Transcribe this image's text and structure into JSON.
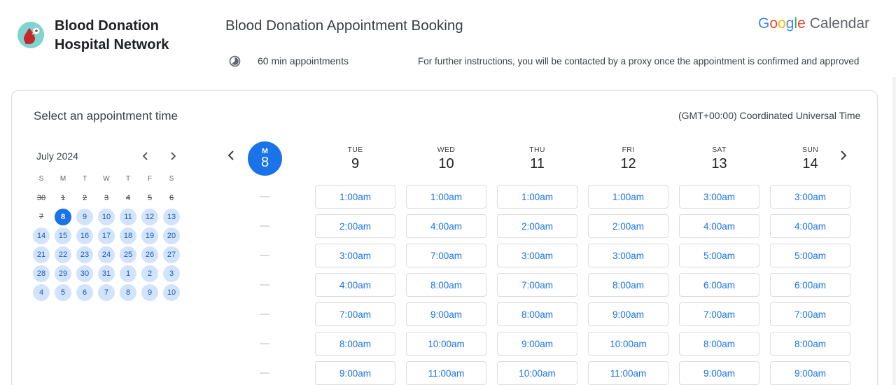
{
  "header": {
    "org_name": "Blood Donation Hospital Network",
    "title": "Blood Donation Appointment Booking",
    "duration": "60 min appointments",
    "instructions": "For further instructions, you will be contacted by a proxy once the appointment is confirmed and approved",
    "brand_google": "Google",
    "brand_calendar": "Calendar"
  },
  "main": {
    "select_title": "Select an appointment time",
    "timezone": "(GMT+00:00) Coordinated Universal Time"
  },
  "mini_calendar": {
    "month_label": "July 2024",
    "weekday_initials": [
      "S",
      "M",
      "T",
      "W",
      "T",
      "F",
      "S"
    ],
    "weeks": [
      [
        {
          "d": "30",
          "s": "past"
        },
        {
          "d": "1",
          "s": "past"
        },
        {
          "d": "2",
          "s": "past"
        },
        {
          "d": "3",
          "s": "past"
        },
        {
          "d": "4",
          "s": "past"
        },
        {
          "d": "5",
          "s": "past"
        },
        {
          "d": "6",
          "s": "past"
        }
      ],
      [
        {
          "d": "7",
          "s": "past"
        },
        {
          "d": "8",
          "s": "selected"
        },
        {
          "d": "9",
          "s": "avail"
        },
        {
          "d": "10",
          "s": "avail"
        },
        {
          "d": "11",
          "s": "avail"
        },
        {
          "d": "12",
          "s": "avail"
        },
        {
          "d": "13",
          "s": "avail"
        }
      ],
      [
        {
          "d": "14",
          "s": "avail"
        },
        {
          "d": "15",
          "s": "avail"
        },
        {
          "d": "16",
          "s": "avail"
        },
        {
          "d": "17",
          "s": "avail"
        },
        {
          "d": "18",
          "s": "avail"
        },
        {
          "d": "19",
          "s": "avail"
        },
        {
          "d": "20",
          "s": "avail"
        }
      ],
      [
        {
          "d": "21",
          "s": "avail"
        },
        {
          "d": "22",
          "s": "avail"
        },
        {
          "d": "23",
          "s": "avail"
        },
        {
          "d": "24",
          "s": "avail"
        },
        {
          "d": "25",
          "s": "avail"
        },
        {
          "d": "26",
          "s": "avail"
        },
        {
          "d": "27",
          "s": "avail"
        }
      ],
      [
        {
          "d": "28",
          "s": "avail"
        },
        {
          "d": "29",
          "s": "avail"
        },
        {
          "d": "30",
          "s": "avail"
        },
        {
          "d": "31",
          "s": "avail"
        },
        {
          "d": "1",
          "s": "avail"
        },
        {
          "d": "2",
          "s": "avail"
        },
        {
          "d": "3",
          "s": "avail"
        }
      ],
      [
        {
          "d": "4",
          "s": "avail"
        },
        {
          "d": "5",
          "s": "avail"
        },
        {
          "d": "6",
          "s": "avail"
        },
        {
          "d": "7",
          "s": "avail"
        },
        {
          "d": "8",
          "s": "avail"
        },
        {
          "d": "9",
          "s": "avail"
        },
        {
          "d": "10",
          "s": "avail"
        }
      ]
    ]
  },
  "week": {
    "today": {
      "dow": "M",
      "date": "8"
    },
    "days": [
      {
        "dow": "TUE",
        "date": "9",
        "slots": [
          "1:00am",
          "2:00am",
          "3:00am",
          "4:00am",
          "7:00am",
          "8:00am",
          "9:00am"
        ]
      },
      {
        "dow": "WED",
        "date": "10",
        "slots": [
          "1:00am",
          "4:00am",
          "7:00am",
          "8:00am",
          "9:00am",
          "10:00am",
          "11:00am"
        ]
      },
      {
        "dow": "THU",
        "date": "11",
        "slots": [
          "1:00am",
          "2:00am",
          "3:00am",
          "7:00am",
          "8:00am",
          "9:00am",
          "10:00am"
        ]
      },
      {
        "dow": "FRI",
        "date": "12",
        "slots": [
          "1:00am",
          "2:00am",
          "3:00am",
          "8:00am",
          "9:00am",
          "10:00am",
          "11:00am"
        ]
      },
      {
        "dow": "SAT",
        "date": "13",
        "slots": [
          "3:00am",
          "4:00am",
          "5:00am",
          "6:00am",
          "7:00am",
          "8:00am",
          "9:00am"
        ]
      },
      {
        "dow": "SUN",
        "date": "14",
        "slots": [
          "3:00am",
          "4:00am",
          "5:00am",
          "6:00am",
          "7:00am",
          "8:00am",
          "9:00am"
        ]
      }
    ]
  },
  "icons": {
    "prev": "chevron-left-icon",
    "next": "chevron-right-icon",
    "duration": "clock-icon"
  },
  "colors": {
    "accent": "#1a73e8",
    "available_day": "#d2e3fc",
    "slot_text": "#1a73e8",
    "border": "#dadce0"
  }
}
